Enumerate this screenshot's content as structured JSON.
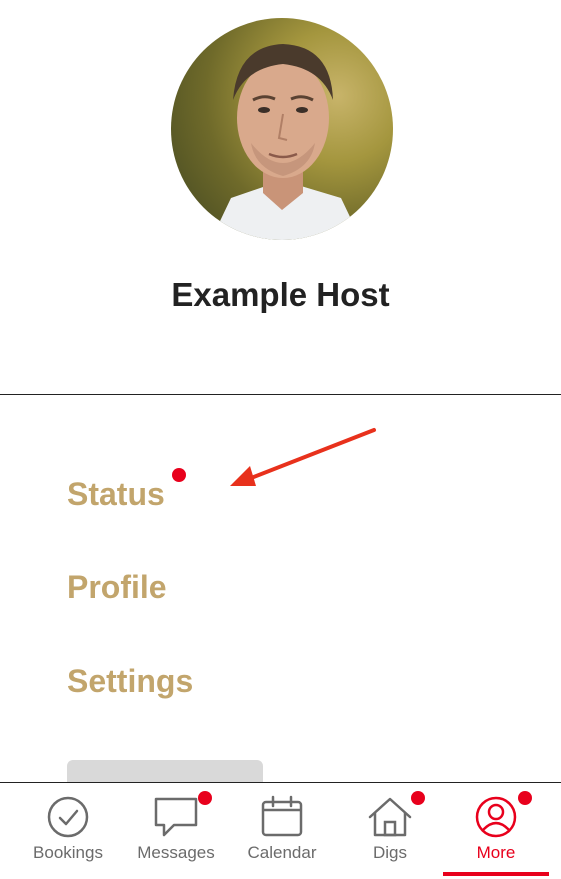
{
  "profile": {
    "name": "Example Host"
  },
  "menu": {
    "items": [
      {
        "label": "Status"
      },
      {
        "label": "Profile"
      },
      {
        "label": "Settings"
      }
    ]
  },
  "colors": {
    "accent": "#c2a56c",
    "notification": "#e8001c",
    "active_tab": "#e8001c",
    "inactive_tab": "#6b6b6b"
  },
  "tabbar": {
    "tabs": [
      {
        "label": "Bookings",
        "icon": "check-circle-icon",
        "badge": false
      },
      {
        "label": "Messages",
        "icon": "chat-bubble-icon",
        "badge": true
      },
      {
        "label": "Calendar",
        "icon": "calendar-icon",
        "badge": false
      },
      {
        "label": "Digs",
        "icon": "house-icon",
        "badge": true
      },
      {
        "label": "More",
        "icon": "user-circle-icon",
        "badge": true,
        "active": true
      }
    ]
  }
}
